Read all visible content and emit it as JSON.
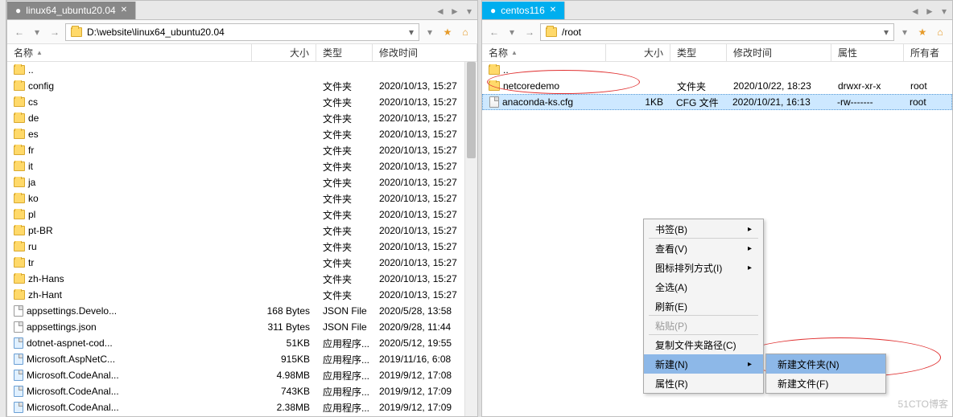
{
  "left": {
    "tab": "linux64_ubuntu20.04",
    "path": "D:\\website\\linux64_ubuntu20.04",
    "cols": {
      "name": "名称",
      "size": "大小",
      "type": "类型",
      "date": "修改时间"
    },
    "up": "..",
    "rows": [
      {
        "n": "config",
        "t": "文件夹",
        "d": "2020/10/13, 15:27",
        "icon": "folder"
      },
      {
        "n": "cs",
        "t": "文件夹",
        "d": "2020/10/13, 15:27",
        "icon": "folder"
      },
      {
        "n": "de",
        "t": "文件夹",
        "d": "2020/10/13, 15:27",
        "icon": "folder"
      },
      {
        "n": "es",
        "t": "文件夹",
        "d": "2020/10/13, 15:27",
        "icon": "folder"
      },
      {
        "n": "fr",
        "t": "文件夹",
        "d": "2020/10/13, 15:27",
        "icon": "folder"
      },
      {
        "n": "it",
        "t": "文件夹",
        "d": "2020/10/13, 15:27",
        "icon": "folder"
      },
      {
        "n": "ja",
        "t": "文件夹",
        "d": "2020/10/13, 15:27",
        "icon": "folder"
      },
      {
        "n": "ko",
        "t": "文件夹",
        "d": "2020/10/13, 15:27",
        "icon": "folder"
      },
      {
        "n": "pl",
        "t": "文件夹",
        "d": "2020/10/13, 15:27",
        "icon": "folder"
      },
      {
        "n": "pt-BR",
        "t": "文件夹",
        "d": "2020/10/13, 15:27",
        "icon": "folder"
      },
      {
        "n": "ru",
        "t": "文件夹",
        "d": "2020/10/13, 15:27",
        "icon": "folder"
      },
      {
        "n": "tr",
        "t": "文件夹",
        "d": "2020/10/13, 15:27",
        "icon": "folder"
      },
      {
        "n": "zh-Hans",
        "t": "文件夹",
        "d": "2020/10/13, 15:27",
        "icon": "folder"
      },
      {
        "n": "zh-Hant",
        "t": "文件夹",
        "d": "2020/10/13, 15:27",
        "icon": "folder"
      },
      {
        "n": "appsettings.Develo...",
        "s": "168 Bytes",
        "t": "JSON File",
        "d": "2020/5/28, 13:58",
        "icon": "file"
      },
      {
        "n": "appsettings.json",
        "s": "311 Bytes",
        "t": "JSON File",
        "d": "2020/9/28, 11:44",
        "icon": "file"
      },
      {
        "n": "dotnet-aspnet-cod...",
        "s": "51KB",
        "t": "应用程序...",
        "d": "2020/5/12, 19:55",
        "icon": "app"
      },
      {
        "n": "Microsoft.AspNetC...",
        "s": "915KB",
        "t": "应用程序...",
        "d": "2019/11/16, 6:08",
        "icon": "app"
      },
      {
        "n": "Microsoft.CodeAnal...",
        "s": "4.98MB",
        "t": "应用程序...",
        "d": "2019/9/12, 17:08",
        "icon": "app"
      },
      {
        "n": "Microsoft.CodeAnal...",
        "s": "743KB",
        "t": "应用程序...",
        "d": "2019/9/12, 17:09",
        "icon": "app"
      },
      {
        "n": "Microsoft.CodeAnal...",
        "s": "2.38MB",
        "t": "应用程序...",
        "d": "2019/9/12, 17:09",
        "icon": "app"
      }
    ]
  },
  "right": {
    "tab": "centos116",
    "path": "/root",
    "cols": {
      "name": "名称",
      "size": "大小",
      "type": "类型",
      "date": "修改时间",
      "attr": "属性",
      "owner": "所有者"
    },
    "up": "..",
    "rows": [
      {
        "n": "netcoredemo",
        "t": "文件夹",
        "d": "2020/10/22, 18:23",
        "a": "drwxr-xr-x",
        "o": "root",
        "icon": "folder"
      },
      {
        "n": "anaconda-ks.cfg",
        "s": "1KB",
        "t": "CFG 文件",
        "d": "2020/10/21, 16:13",
        "a": "-rw-------",
        "o": "root",
        "icon": "cfg",
        "sel": true
      }
    ]
  },
  "menu": {
    "bookmarks": "书签(B)",
    "view": "查看(V)",
    "icon_arrange": "图标排列方式(I)",
    "select_all": "全选(A)",
    "refresh": "刷新(E)",
    "paste": "粘贴(P)",
    "copy_path": "复制文件夹路径(C)",
    "new": "新建(N)",
    "properties": "属性(R)",
    "new_folder": "新建文件夹(N)",
    "new_file": "新建文件(F)"
  },
  "watermark": "51CTO博客"
}
